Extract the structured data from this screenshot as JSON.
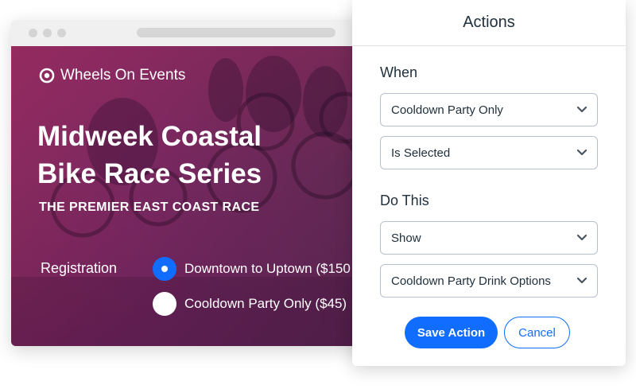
{
  "event_page": {
    "brand": "Wheels On Events",
    "title": "Midweek Coastal Bike Race Series",
    "subtitle": "THE PREMIER EAST COAST RACE",
    "registration_label": "Registration",
    "options": [
      {
        "label": "Downtown to Uptown ($150",
        "selected": true
      },
      {
        "label": "Cooldown Party Only ($45)",
        "selected": false
      }
    ]
  },
  "actions_panel": {
    "title": "Actions",
    "when_label": "When",
    "when_field": "Cooldown Party Only",
    "when_condition": "Is Selected",
    "do_label": "Do This",
    "do_action": "Show",
    "do_target": "Cooldown Party Drink Options",
    "save_label": "Save Action",
    "cancel_label": "Cancel"
  },
  "colors": {
    "accent": "#116dff",
    "hero_tint": "#7d2a63",
    "text_dark": "#20303c"
  },
  "icons": {
    "brand": "target-icon",
    "dropdown": "chevron-down-icon"
  }
}
